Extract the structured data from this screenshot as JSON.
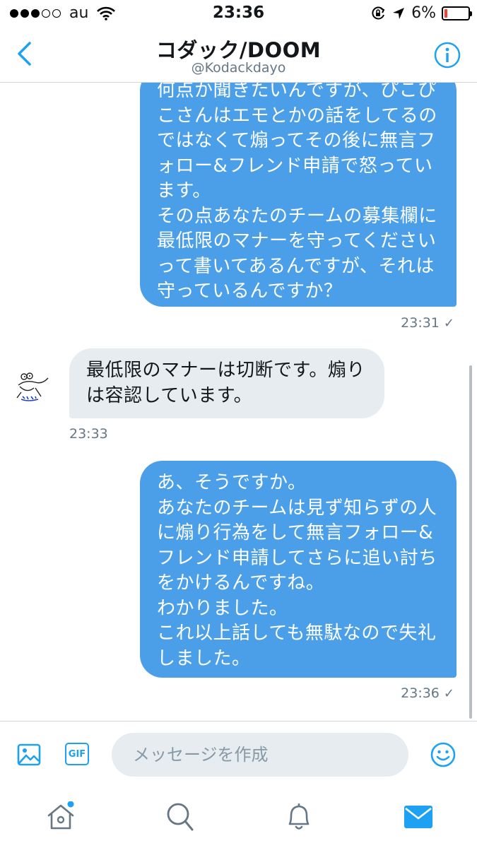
{
  "status_bar": {
    "carrier": "au",
    "time": "23:36",
    "battery": "6%"
  },
  "header": {
    "title": "コダック/DOOM",
    "handle": "@Kodackdayo"
  },
  "messages": [
    {
      "direction": "sent",
      "lines": [
        "何点か聞きたいんですが、ぴこぴ",
        "こさんはエモとかの話をしてるの",
        "ではなくて煽ってその後に無言フ",
        "ォロー&フレンド申請で怒ってい",
        "ます。",
        "その点あなたのチームの募集欄に",
        "最低限のマナーを守ってください",
        "って書いてあるんですが、それは",
        "守っているんですか？"
      ],
      "time": "23:31",
      "status": "✓"
    },
    {
      "direction": "received",
      "lines": [
        "最低限のマナーは切断です。煽り",
        "は容認しています。"
      ],
      "time": "23:33"
    },
    {
      "direction": "sent",
      "lines": [
        "あ、そうですか。",
        "あなたのチームは見ず知らずの人",
        "に煽り行為をして無言フォロー&",
        "フレンド申請してさらに追い討ち",
        "をかけるんですね。",
        "わかりました。",
        "これ以上話しても無駄なので失礼",
        "しました。"
      ],
      "time": "23:36",
      "status": "✓"
    }
  ],
  "composer": {
    "placeholder": "メッセージを作成",
    "gif_label": "GIF"
  },
  "colors": {
    "accent": "#1da1f2",
    "sent_bubble": "#4a9fe8",
    "received_bubble": "#e6ecf0",
    "battery_low": "#ff3b30"
  },
  "icons": [
    "back-chevron-icon",
    "info-icon",
    "image-icon",
    "gif-icon",
    "emoji-icon",
    "home-icon",
    "search-icon",
    "notifications-bell-icon",
    "messages-envelope-icon"
  ]
}
